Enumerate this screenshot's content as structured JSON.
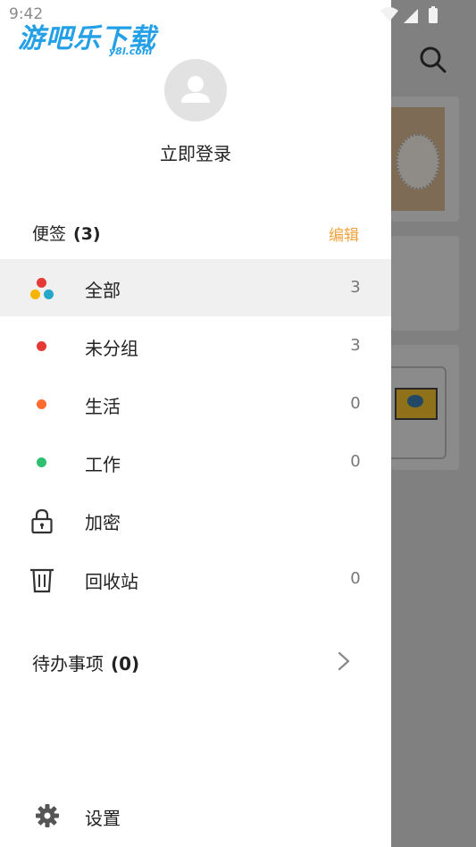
{
  "status": {
    "time": "9:42"
  },
  "watermark": {
    "text": "游吧乐下载",
    "sub": "y8l.com"
  },
  "account": {
    "login_label": "立即登录"
  },
  "notes_section": {
    "title": "便签",
    "count": "(3)",
    "edit_label": "编辑"
  },
  "groups": [
    {
      "label": "全部",
      "count": "3",
      "icon": "multi-color-dots-icon",
      "colors": [
        "#e53935",
        "#f4b400",
        "#26a6c9"
      ]
    },
    {
      "label": "未分组",
      "count": "3",
      "icon": "red-dot-icon",
      "color": "#e53935"
    },
    {
      "label": "生活",
      "count": "0",
      "icon": "orange-dot-icon",
      "color": "#ff6d2e"
    },
    {
      "label": "工作",
      "count": "0",
      "icon": "green-dot-icon",
      "color": "#2fbf71"
    },
    {
      "label": "加密",
      "count": "",
      "icon": "lock-icon"
    },
    {
      "label": "回收站",
      "count": "0",
      "icon": "trash-icon"
    }
  ],
  "todo": {
    "title": "待办事项",
    "count": "(0)"
  },
  "settings": {
    "label": "设置",
    "icon": "gear-icon"
  },
  "colors": {
    "accent": "#f2a23a",
    "active_row": "#f0f0f0",
    "overlay": "#7a7a7a"
  }
}
